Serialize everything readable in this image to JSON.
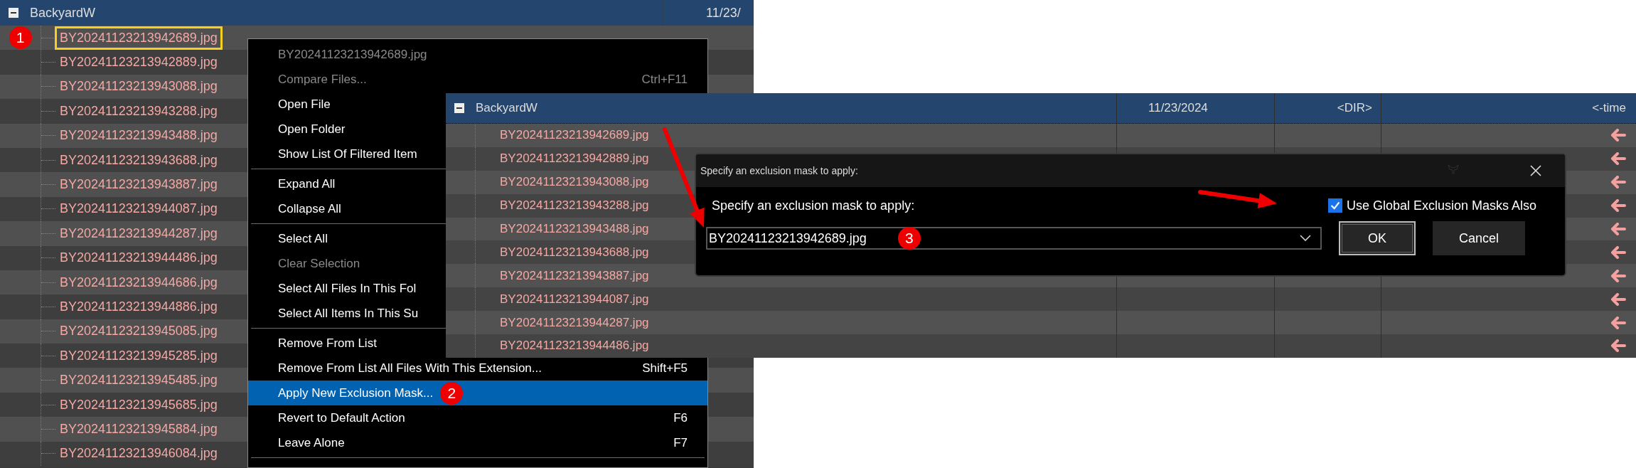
{
  "background_window": {
    "root": {
      "label": "BackyardW",
      "expanded": true
    },
    "header_date": "11/23/",
    "files": [
      {
        "name": "BY20241123213942689.jpg",
        "outlined": true,
        "callout": "1"
      },
      {
        "name": "BY20241123213942889.jpg",
        "outlined": false
      },
      {
        "name": "BY20241123213943088.jpg",
        "outlined": false
      },
      {
        "name": "BY20241123213943288.jpg",
        "outlined": false
      },
      {
        "name": "BY20241123213943488.jpg",
        "outlined": false
      },
      {
        "name": "BY20241123213943688.jpg",
        "outlined": false
      },
      {
        "name": "BY20241123213943887.jpg",
        "outlined": false
      },
      {
        "name": "BY20241123213944087.jpg",
        "outlined": false
      },
      {
        "name": "BY20241123213944287.jpg",
        "outlined": false
      },
      {
        "name": "BY20241123213944486.jpg",
        "outlined": false
      },
      {
        "name": "BY20241123213944686.jpg",
        "outlined": false
      },
      {
        "name": "BY20241123213944886.jpg",
        "outlined": false
      },
      {
        "name": "BY20241123213945085.jpg",
        "outlined": false
      },
      {
        "name": "BY20241123213945285.jpg",
        "outlined": false
      },
      {
        "name": "BY20241123213945485.jpg",
        "outlined": false
      },
      {
        "name": "BY20241123213945685.jpg",
        "outlined": false
      },
      {
        "name": "BY20241123213945884.jpg",
        "outlined": false
      },
      {
        "name": "BY20241123213946084.jpg",
        "outlined": false
      }
    ]
  },
  "context_menu": {
    "items": [
      {
        "kind": "item",
        "label": "BY20241123213942689.jpg",
        "disabled": true,
        "selected": false
      },
      {
        "kind": "item",
        "label": "Compare Files...",
        "shortcut": "Ctrl+F11",
        "disabled": true,
        "selected": false
      },
      {
        "kind": "item",
        "label": "Open File",
        "disabled": false,
        "selected": false
      },
      {
        "kind": "item",
        "label": "Open Folder",
        "disabled": false,
        "selected": false
      },
      {
        "kind": "item",
        "label": "Show List Of Filtered Item",
        "disabled": false,
        "selected": false
      },
      {
        "kind": "separator"
      },
      {
        "kind": "item",
        "label": "Expand All",
        "disabled": false,
        "selected": false
      },
      {
        "kind": "item",
        "label": "Collapse All",
        "disabled": false,
        "selected": false
      },
      {
        "kind": "separator"
      },
      {
        "kind": "item",
        "label": "Select All",
        "disabled": false,
        "selected": false
      },
      {
        "kind": "item",
        "label": "Clear Selection",
        "disabled": true,
        "selected": false
      },
      {
        "kind": "item",
        "label": "Select All Files In This Fol",
        "disabled": false,
        "selected": false
      },
      {
        "kind": "item",
        "label": "Select All Items In This Su",
        "disabled": false,
        "selected": false
      },
      {
        "kind": "separator"
      },
      {
        "kind": "item",
        "label": "Remove From List",
        "disabled": false,
        "selected": false
      },
      {
        "kind": "item",
        "label": "Remove From List All Files With This Extension...",
        "shortcut": "Shift+F5",
        "disabled": false,
        "selected": false
      },
      {
        "kind": "item",
        "label": "Apply New Exclusion Mask...",
        "disabled": false,
        "selected": true,
        "callout": "2"
      },
      {
        "kind": "item",
        "label": "Revert to Default Action",
        "shortcut": "F6",
        "disabled": false,
        "selected": false
      },
      {
        "kind": "item",
        "label": "Leave Alone",
        "shortcut": "F7",
        "disabled": false,
        "selected": false
      },
      {
        "kind": "separator"
      }
    ]
  },
  "foreground_window": {
    "root": {
      "label": "BackyardW",
      "expanded": true
    },
    "header": {
      "date": "11/23/2024",
      "size": "<DIR>",
      "action": "<-time"
    },
    "files": [
      {
        "name": "BY20241123213942689.jpg"
      },
      {
        "name": "BY20241123213942889.jpg"
      },
      {
        "name": "BY20241123213943088.jpg"
      },
      {
        "name": "BY20241123213943288.jpg"
      },
      {
        "name": "BY20241123213943488.jpg"
      },
      {
        "name": "BY20241123213943688.jpg"
      },
      {
        "name": "BY20241123213943887.jpg"
      },
      {
        "name": "BY20241123213944087.jpg"
      },
      {
        "name": "BY20241123213944287.jpg"
      },
      {
        "name": "BY20241123213944486.jpg"
      }
    ]
  },
  "dialog": {
    "title": "Specify an exclusion mask to apply:",
    "label": "Specify an exclusion mask to apply:",
    "mask_value": "BY20241123213942689.jpg",
    "callout": "3",
    "use_global": {
      "label": "Use Global Exclusion Masks Also",
      "checked": true
    },
    "buttons": [
      {
        "label": "OK",
        "default": true
      },
      {
        "label": "Cancel",
        "default": false
      }
    ]
  }
}
